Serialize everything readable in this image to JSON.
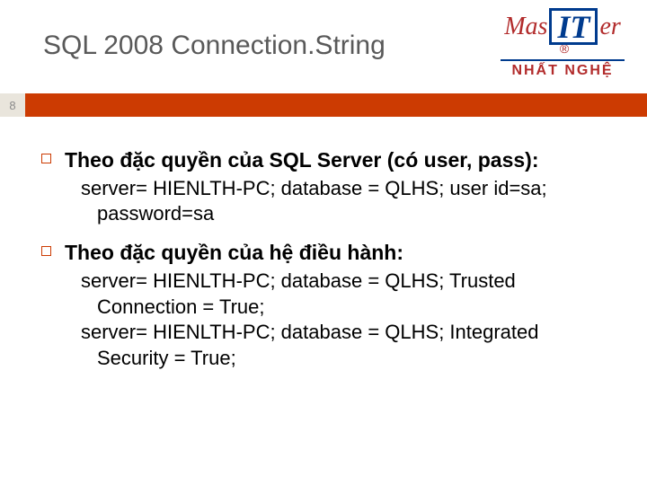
{
  "header": {
    "title": "SQL 2008 Connection.String",
    "logo": {
      "word_left": "Mas",
      "it_box": "IT",
      "word_right": "er",
      "reg": "®",
      "subtitle": "NHẤT NGHỆ"
    }
  },
  "accent": {
    "page_number": "8"
  },
  "content": {
    "items": [
      {
        "heading": "Theo đặc quyền của SQL Server (có user, pass):",
        "lines": [
          "server= HIENLTH-PC; database = QLHS; user id=sa; password=sa"
        ]
      },
      {
        "heading": "Theo đặc quyền của hệ điều hành:",
        "lines": [
          "server= HIENLTH-PC; database = QLHS; Trusted Connection = True;",
          "server= HIENLTH-PC; database = QLHS; Integrated Security = True;"
        ]
      }
    ]
  }
}
